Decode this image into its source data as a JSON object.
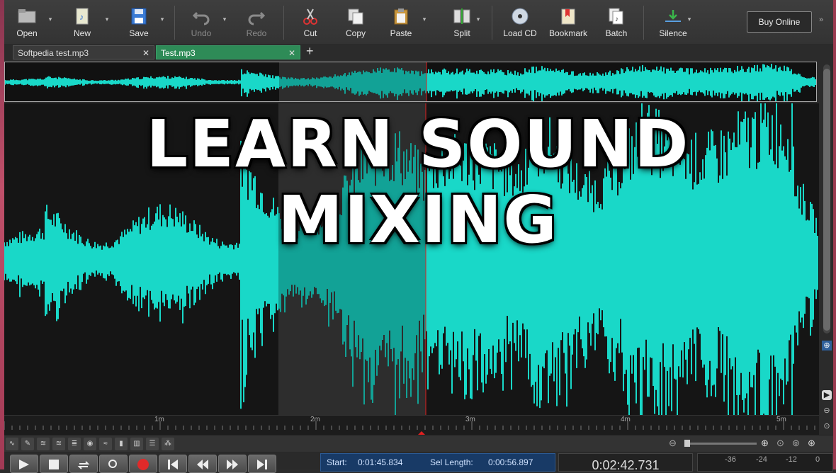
{
  "toolbar": {
    "open": "Open",
    "new": "New",
    "save": "Save",
    "undo": "Undo",
    "redo": "Redo",
    "cut": "Cut",
    "copy": "Copy",
    "paste": "Paste",
    "split": "Split",
    "load_cd": "Load CD",
    "bookmark": "Bookmark",
    "batch": "Batch",
    "silence": "Silence",
    "buy_online": "Buy Online"
  },
  "tabs": [
    {
      "label": "Softpedia test.mp3",
      "active": false
    },
    {
      "label": "Test.mp3",
      "active": true
    }
  ],
  "headline": "LEARN SOUND MIXING",
  "ruler": {
    "labels": [
      "1m",
      "2m",
      "3m",
      "4m",
      "5m"
    ]
  },
  "selection": {
    "start_label": "Start:",
    "start_value": "0:01:45.834",
    "length_label": "Sel Length:",
    "length_value": "0:00:56.897"
  },
  "current_time": "0:02:42.731",
  "meter": {
    "labels": [
      "-36",
      "-24",
      "-12",
      "0"
    ]
  },
  "colors": {
    "waveform": "#19d8c8",
    "selection": "#3a3a3a",
    "playhead": "#e02020",
    "active_tab": "#2e8b57",
    "info_panel": "#183a66"
  }
}
